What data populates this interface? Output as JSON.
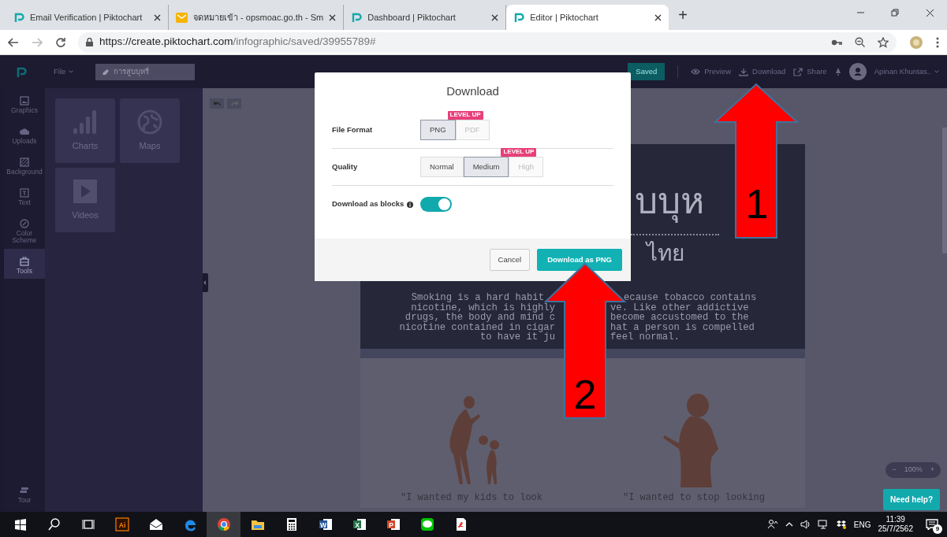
{
  "browser": {
    "tabs": [
      {
        "title": "Email Verification | Piktochart",
        "selected": false
      },
      {
        "title": "จดหมายเข้า - opsmoac.go.th - Sm",
        "selected": false
      },
      {
        "title": "Dashboard | Piktochart",
        "selected": false
      },
      {
        "title": "Editor | Piktochart",
        "selected": true
      }
    ],
    "new_tab": "+",
    "url_host": "https://create.piktochart.com",
    "url_path": "/infographic/saved/39955789#"
  },
  "app_header": {
    "file_menu": "File",
    "document_title": "การสูบบุหรี่",
    "saved": "Saved",
    "actions": [
      "Preview",
      "Download",
      "Share"
    ],
    "user": "Apinan Khuntas.."
  },
  "rail": [
    {
      "label": "Graphics",
      "selected": false
    },
    {
      "label": "Uploads",
      "selected": false
    },
    {
      "label": "Background",
      "selected": false
    },
    {
      "label": "Text",
      "selected": false
    },
    {
      "label": "Color Scheme",
      "selected": false
    },
    {
      "label": "Tools",
      "selected": true
    }
  ],
  "tour": "Tour",
  "panel": {
    "tiles": [
      "Charts",
      "Maps",
      "Videos"
    ]
  },
  "canvas": {
    "title_fragment": "บบุห",
    "subtitle_fragment": "ไทย",
    "paragraph": [
      {
        "left": "Smoking is a hard habit",
        "right": "ecause tobacco contains"
      },
      {
        "left": "nicotine, which is highly",
        "right": "ve. Like other addictive"
      },
      {
        "left": "drugs, the body and mind c",
        "right": "become accustomed to the"
      },
      {
        "left": "nicotine contained in cigar",
        "right": "hat a person is compelled"
      },
      {
        "left": "to have it ju",
        "right": "feel normal."
      }
    ],
    "quotes": [
      "\"I wanted my kids to look",
      "\"I wanted to stop looking"
    ]
  },
  "zoom": {
    "minus": "−",
    "value": "100%",
    "plus": "+"
  },
  "help": "Need help?",
  "dialog": {
    "title": "Download",
    "rows": [
      {
        "kind": "segmented",
        "label": "File Format",
        "badge": "LEVEL UP",
        "options": [
          {
            "label": "PNG",
            "selected": true,
            "locked": false
          },
          {
            "label": "PDF",
            "selected": false,
            "locked": true
          }
        ]
      },
      {
        "kind": "segmented",
        "label": "Quality",
        "badge": "LEVEL UP",
        "options": [
          {
            "label": "Normal",
            "selected": false,
            "locked": false
          },
          {
            "label": "Medium",
            "selected": true,
            "locked": false
          },
          {
            "label": "High",
            "selected": false,
            "locked": true
          }
        ]
      },
      {
        "kind": "toggle",
        "label": "Download as blocks",
        "on": true
      }
    ],
    "buttons": [
      {
        "kind": "secondary",
        "label": "Cancel"
      },
      {
        "kind": "primary",
        "label": "Download as PNG"
      }
    ]
  },
  "annotations": [
    {
      "number": "1"
    },
    {
      "number": "2"
    }
  ],
  "taskbar": {
    "apps": [
      {
        "active": false
      },
      {
        "active": false
      },
      {
        "active": false
      },
      {
        "glyph": "Ai",
        "active": false
      },
      {
        "active": false
      },
      {
        "active": false
      },
      {
        "active": true
      },
      {
        "active": false
      },
      {
        "active": false
      },
      {
        "glyph": "W",
        "active": false
      },
      {
        "glyph": "X",
        "active": false
      },
      {
        "glyph": "P",
        "active": false
      },
      {
        "active": false
      },
      {
        "active": false
      }
    ],
    "tray": {
      "language": "ENG",
      "time": "11:39",
      "date": "25/7/2562",
      "notifications": "9"
    }
  }
}
